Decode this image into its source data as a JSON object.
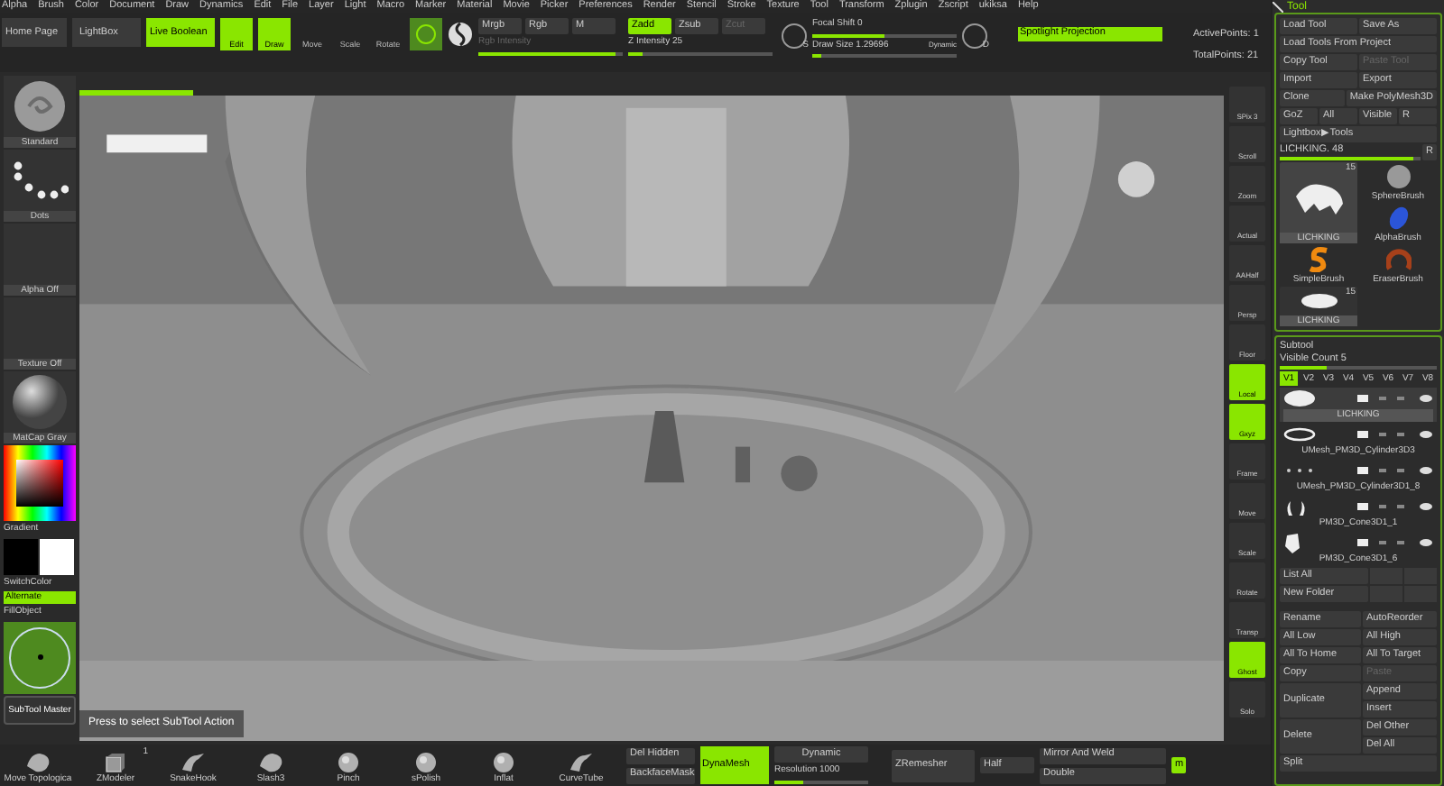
{
  "menu": [
    "Alpha",
    "Brush",
    "Color",
    "Document",
    "Draw",
    "Dynamics",
    "Edit",
    "File",
    "Layer",
    "Light",
    "Macro",
    "Marker",
    "Material",
    "Movie",
    "Picker",
    "Preferences",
    "Render",
    "Stencil",
    "Stroke",
    "Texture",
    "Tool",
    "Transform",
    "Zplugin",
    "Zscript",
    "ukiksa",
    "Help"
  ],
  "shelf": {
    "home": "Home Page",
    "lightbox": "LightBox",
    "live_boolean": {
      "label": "Live Boolean",
      "on": true
    },
    "modes": [
      {
        "label": "Edit",
        "selected": true
      },
      {
        "label": "Draw",
        "selected": true
      },
      {
        "label": "Move",
        "selected": false
      },
      {
        "label": "Scale",
        "selected": false
      },
      {
        "label": "Rotate",
        "selected": false
      }
    ],
    "rgb": [
      "Mrgb",
      "Rgb",
      "M"
    ],
    "rgb_intensity": {
      "label": "Rgb Intensity",
      "level": 0.95
    },
    "z_modes": [
      {
        "label": "Zadd",
        "selected": true,
        "disabled": false
      },
      {
        "label": "Zsub",
        "selected": false,
        "disabled": false
      },
      {
        "label": "Zcut",
        "selected": false,
        "disabled": true
      }
    ],
    "z_intensity": {
      "label": "Z Intensity 25",
      "level": 0.1
    },
    "focal_shift": {
      "label": "Focal Shift 0",
      "level": 0.5
    },
    "draw_size": {
      "label": "Draw Size 1.29696",
      "level": 0.06
    },
    "dynamic": "Dynamic",
    "brush_s": "S",
    "brush_d": "D",
    "spotlight": "Spotlight Projection",
    "active_points": "ActivePoints: 1",
    "total_points": "TotalPoints: 21"
  },
  "left": {
    "tiles": [
      {
        "label": "Standard",
        "kind": "brush"
      },
      {
        "label": "Dots",
        "kind": "stroke"
      },
      {
        "label": "Alpha Off",
        "kind": "empty"
      },
      {
        "label": "Texture Off",
        "kind": "empty"
      },
      {
        "label": "MatCap Gray",
        "kind": "sphere"
      }
    ],
    "gradient": "Gradient",
    "switch_color": "SwitchColor",
    "alternate": {
      "label": "Alternate",
      "on": true
    },
    "fill_object": "FillObject",
    "subtool_master": "SubTool Master"
  },
  "canvas": {
    "progress": {
      "level": 0.1
    },
    "tooltip": "Press to select SubTool Action"
  },
  "right_tools": [
    {
      "label": "SPix 3",
      "on": false
    },
    {
      "label": "Scroll",
      "on": false
    },
    {
      "label": "Zoom",
      "on": false
    },
    {
      "label": "Actual",
      "on": false
    },
    {
      "label": "AAHalf",
      "on": false
    },
    {
      "label": "Persp",
      "on": false
    },
    {
      "label": "Floor",
      "on": false
    },
    {
      "label": "Local",
      "on": true
    },
    {
      "label": "Gxyz",
      "on": true
    },
    {
      "label": "Frame",
      "on": false
    },
    {
      "label": "Move",
      "on": false
    },
    {
      "label": "Scale",
      "on": false
    },
    {
      "label": "Rotate",
      "on": false
    },
    {
      "label": "Transp",
      "on": false
    },
    {
      "label": "Ghost",
      "on": true
    },
    {
      "label": "Solo",
      "on": false
    }
  ],
  "tool_panel": {
    "title": "Tool",
    "rows": [
      [
        {
          "label": "Load Tool",
          "disabled": false
        },
        {
          "label": "Save As",
          "disabled": false
        }
      ],
      [
        {
          "label": "Load Tools From Project",
          "disabled": false
        }
      ],
      [
        {
          "label": "Copy Tool",
          "disabled": false
        },
        {
          "label": "Paste Tool",
          "disabled": true
        }
      ],
      [
        {
          "label": "Import",
          "disabled": false
        },
        {
          "label": "Export",
          "disabled": false
        }
      ],
      [
        {
          "label": "Clone",
          "disabled": false
        },
        {
          "label": "Make PolyMesh3D",
          "disabled": false
        }
      ],
      [
        {
          "label": "GoZ",
          "disabled": false
        },
        {
          "label": "All",
          "disabled": false
        },
        {
          "label": "Visible",
          "disabled": false
        },
        {
          "label": "R",
          "disabled": false
        }
      ],
      [
        {
          "label": "Lightbox▶Tools",
          "disabled": false
        }
      ]
    ],
    "slider": {
      "label": "LICHKING. 48",
      "level": 0.95,
      "reset": "R"
    },
    "tools": [
      {
        "name": "LICHKING",
        "count": "15",
        "kind": "mesh",
        "selected": true
      },
      {
        "name": "SphereBrush",
        "kind": "sphere",
        "selected": false
      },
      {
        "name": "AlphaBrush",
        "kind": "alpha",
        "selected": false
      },
      {
        "name": "SimpleBrush",
        "kind": "simple",
        "selected": false
      },
      {
        "name": "EraserBrush",
        "kind": "eraser",
        "selected": false
      },
      {
        "name": "LICHKING",
        "count": "15",
        "kind": "disc",
        "selected": false
      }
    ]
  },
  "subtool": {
    "title": "Subtool",
    "visible_count": {
      "label": "Visible Count 5",
      "level": 0.3
    },
    "tabs": [
      {
        "label": "V1",
        "selected": true
      },
      {
        "label": "V2",
        "selected": false
      },
      {
        "label": "V3",
        "selected": false
      },
      {
        "label": "V4",
        "selected": false
      },
      {
        "label": "V5",
        "selected": false
      },
      {
        "label": "V6",
        "selected": false
      },
      {
        "label": "V7",
        "selected": false
      },
      {
        "label": "V8",
        "selected": false
      }
    ],
    "items": [
      {
        "name": "LICHKING",
        "selected": true,
        "kind": "blob"
      },
      {
        "name": "UMesh_PM3D_Cylinder3D3",
        "selected": false,
        "kind": "ring"
      },
      {
        "name": "UMesh_PM3D_Cylinder3D1_8",
        "selected": false,
        "kind": "dots"
      },
      {
        "name": "PM3D_Cone3D1_1",
        "selected": false,
        "kind": "horns"
      },
      {
        "name": "PM3D_Cone3D1_6",
        "selected": false,
        "kind": "shard"
      }
    ],
    "list_all": "List All",
    "new_folder": "New Folder",
    "actions": [
      {
        "left": "Rename",
        "right": [
          "AutoReorder"
        ]
      },
      {
        "left": "All Low",
        "right": [
          "All High"
        ]
      },
      {
        "left": "All To Home",
        "right": [
          "All To Target"
        ]
      },
      {
        "left": "Copy",
        "right": [
          "Paste"
        ],
        "right_disabled": true
      },
      {
        "left": "Duplicate",
        "right": [
          "Append",
          "Insert"
        ]
      },
      {
        "left": "Delete",
        "right": [
          "Del Other",
          "Del All"
        ]
      },
      {
        "left": "Split"
      }
    ]
  },
  "bottom": {
    "brushes": [
      {
        "label": "Move Topologica",
        "kind": "rock"
      },
      {
        "label": "ZModeler",
        "kind": "cube",
        "badge": "1"
      },
      {
        "label": "SnakeHook",
        "kind": "hook"
      },
      {
        "label": "Slash3",
        "kind": "rock"
      },
      {
        "label": "Pinch",
        "kind": "ball"
      },
      {
        "label": "sPolish",
        "kind": "ball"
      },
      {
        "label": "Inflat",
        "kind": "ball"
      },
      {
        "label": "CurveTube",
        "kind": "hook"
      }
    ],
    "del_hidden": "Del Hidden",
    "backface_mask": "BackfaceMask",
    "dynamesh": {
      "label": "DynaMesh",
      "on": true
    },
    "dynamic": "Dynamic",
    "resolution": {
      "label": "Resolution 1000",
      "level": 0.3
    },
    "zremesher": "ZRemesher",
    "half": "Half",
    "mirror": "Mirror And Weld",
    "double": "Double",
    "m": "m"
  }
}
